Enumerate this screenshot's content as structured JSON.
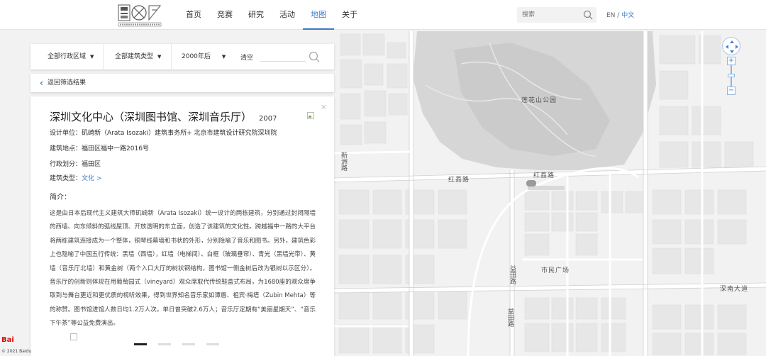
{
  "header": {
    "nav": [
      {
        "label": "首页",
        "active": false
      },
      {
        "label": "竞赛",
        "active": false
      },
      {
        "label": "研究",
        "active": false
      },
      {
        "label": "活动",
        "active": false
      },
      {
        "label": "地图",
        "active": true
      },
      {
        "label": "关于",
        "active": false
      }
    ],
    "search_placeholder": "搜索",
    "lang_en": "EN",
    "lang_sep": "/",
    "lang_zh": "中文",
    "accent": "#3a7bc8"
  },
  "filters": {
    "district": "全部行政区域",
    "type": "全部建筑类型",
    "year": "2000年后",
    "clear": "清空",
    "search_value": ""
  },
  "back_label": "返回筛选结果",
  "building": {
    "title": "深圳文化中心（深圳图书馆、深圳音乐厅）",
    "year": "2007",
    "designer_label": "设计单位：",
    "designer": "矶崎新（Arata Isozaki）建筑事务所+ 北京市建筑设计研究院深圳院",
    "location_label": "建筑地点：",
    "location": "福田区福中一路2016号",
    "district_label": "行政划分：",
    "district": "福田区",
    "type_label": "建筑类型：",
    "type": "文化 >",
    "intro_heading": "简介：",
    "intro": "这是由日本后现代主义建筑大师矶崎新（Arata Isozaki）统一设计的两栋建筑，分别通过封闭隔墙的西墙、向东倾斜的弧线屋顶、开放透明的东立面，创造了该建筑的文化性。跨越福中一路的大平台将两栋建筑连接成为一个整体，铜琴线幕墙和书状的外形，分别隐喻了音乐和图书。另外，建筑色彩上也隐喻了中国五行传统：黑墙（西墙），红墙（电梯间）、白框（玻璃垂帘）、青光（黑墙光带）、黄墙（音乐厅北墙）和黄金树（两个入口大厅的树状钢结构，图书馆一侧金树后改为银树以示区分）。音乐厅的创新则体现在用葡萄园式（vineyard）观众席取代传统鞋盒式布局，为1680座的观众席争取到与舞台更近和更优质的视听效果，得到世界知名音乐家如谭盾、祖宾·梅塔（Zubin Mehta）等的称赞。图书馆进馆人数日均1.2万人次，单日曾突破2.6万人；音乐厅定期有“美丽星期天”、“音乐下午茶”等公益免费演出。",
    "carousel_count": 4,
    "carousel_active": 0
  },
  "map": {
    "labels": {
      "park": "莲花山公园",
      "hongli_1": "红荔路",
      "hongli_2": "红荔路",
      "civic_square": "市民广场",
      "yitian_1": "益田路",
      "yitian_2": "益田路",
      "shennan": "深南大道",
      "xinzhou": "新洲路"
    },
    "marker_color": "#e53935"
  },
  "baidu": {
    "logo": "Bai",
    "copyright": "© 2021 Baidu"
  }
}
